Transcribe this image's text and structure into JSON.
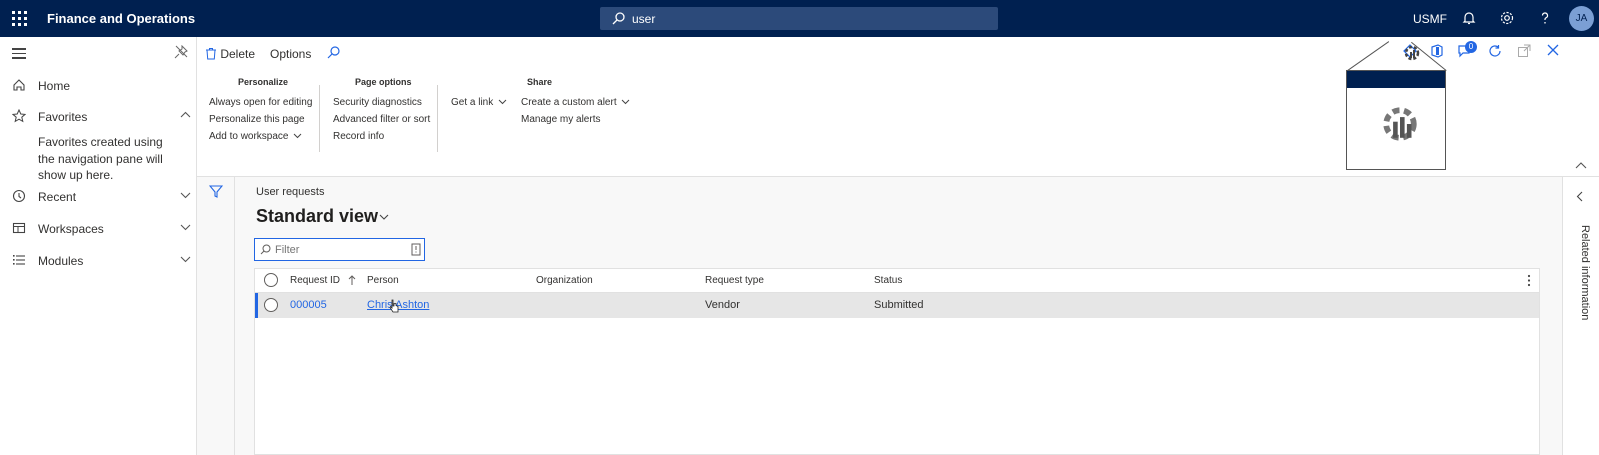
{
  "app": {
    "title": "Finance and Operations",
    "company": "USMF",
    "user_initials": "JA"
  },
  "search": {
    "value": "user"
  },
  "nav": {
    "items": [
      {
        "label": "Home",
        "icon": "home-icon"
      },
      {
        "label": "Favorites",
        "icon": "star-icon"
      },
      {
        "label": "Recent",
        "icon": "clock-icon"
      },
      {
        "label": "Workspaces",
        "icon": "workspace-icon"
      },
      {
        "label": "Modules",
        "icon": "modules-icon"
      }
    ],
    "favorites_note": "Favorites created using the navigation pane will show up here."
  },
  "actionpane": {
    "delete_label": "Delete",
    "options_tab": "Options",
    "groups": {
      "personalize": {
        "title": "Personalize",
        "items": [
          "Always open for editing",
          "Personalize this page",
          "Add to workspace"
        ]
      },
      "page_options": {
        "title": "Page options",
        "items": [
          "Security diagnostics",
          "Advanced filter or sort",
          "Record info"
        ]
      },
      "share": {
        "title": "Share",
        "get_link": "Get a link",
        "items": [
          "Create a custom alert",
          "Manage my alerts"
        ]
      }
    },
    "notification_count": "0"
  },
  "page": {
    "caption": "User requests",
    "view_title": "Standard view",
    "filter_placeholder": "Filter"
  },
  "grid": {
    "columns": [
      "Request ID",
      "Person",
      "Organization",
      "Request type",
      "Status"
    ],
    "rows": [
      {
        "request_id": "000005",
        "person": "Chris Ashton",
        "organization": "",
        "request_type": "Vendor",
        "status": "Submitted"
      }
    ]
  },
  "rightrail": {
    "label": "Related information"
  },
  "colors": {
    "topbar": "#002050",
    "accent": "#2266e3"
  }
}
